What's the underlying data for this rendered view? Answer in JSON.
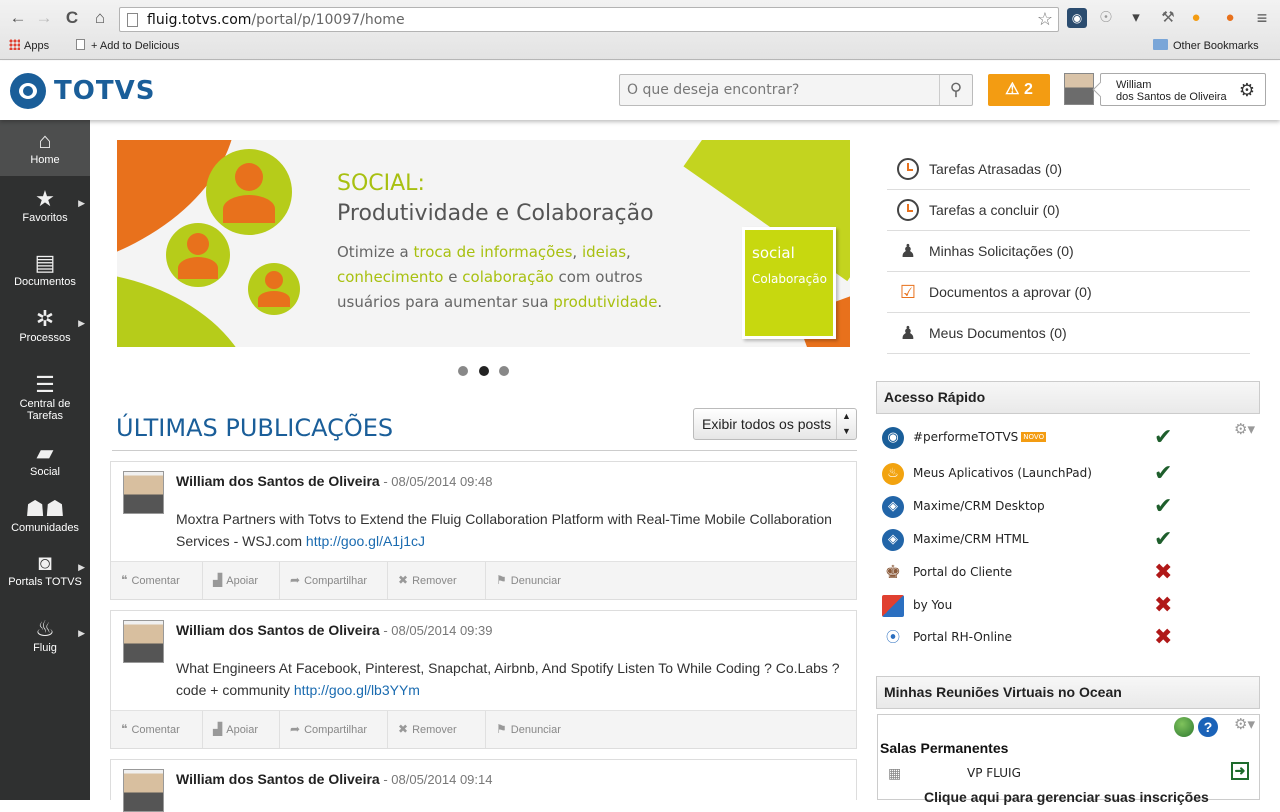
{
  "browser": {
    "url_host": "fluig.totvs.com",
    "url_path": "/portal/p/10097/home",
    "bookmarks": {
      "apps": "Apps",
      "delicious": "+ Add to Delicious",
      "other": "Other Bookmarks"
    }
  },
  "header": {
    "logo": "TOTVS",
    "search_placeholder": "O que deseja encontrar?",
    "alert_count": "2",
    "user_first": "William",
    "user_rest": "dos Santos de Oliveira"
  },
  "sidebar": {
    "items": [
      {
        "label": "Home",
        "icon": "home-icon"
      },
      {
        "label": "Favoritos",
        "icon": "star-icon"
      },
      {
        "label": "Documentos",
        "icon": "documents-icon"
      },
      {
        "label": "Processos",
        "icon": "process-icon"
      },
      {
        "label": "Central de",
        "label2": "Tarefas",
        "icon": "list-icon"
      },
      {
        "label": "Social",
        "icon": "chat-icon"
      },
      {
        "label": "Comunidades",
        "icon": "community-icon"
      },
      {
        "label": "Portals TOTVS",
        "icon": "portal-icon"
      },
      {
        "label": "Fluig",
        "icon": "fluig-icon"
      }
    ]
  },
  "banner": {
    "title": "SOCIAL:",
    "subtitle": "Produtividade e Colaboração",
    "t1": "Otimize a ",
    "h1": "troca de informações",
    "t2": ", ",
    "h2": "ideias",
    "t3": ",",
    "h3": "conhecimento",
    "t4": " e ",
    "h4": "colaboração",
    "t5": " com outros",
    "t6": "usuários para aumentar sua ",
    "h5": "produtividade",
    "t7": ".",
    "box_title": "social",
    "box_sub": "Colaboração",
    "active_slide": 2,
    "slides": 3
  },
  "feed": {
    "title": "ÚLTIMAS PUBLICAÇÕES",
    "filter": "Exibir todos os posts",
    "actions": [
      "Comentar",
      "Apoiar",
      "Compartilhar",
      "Remover",
      "Denunciar"
    ],
    "posts": [
      {
        "author": "William dos Santos de Oliveira",
        "date": " - 08/05/2014 09:48",
        "text": "Moxtra Partners with Totvs to Extend the Fluig Collaboration Platform with Real-Time Mobile Collaboration Services - WSJ.com ",
        "link": "http://goo.gl/A1j1cJ"
      },
      {
        "author": "William dos Santos de Oliveira",
        "date": " - 08/05/2014 09:39",
        "text": "What Engineers At Facebook, Pinterest, Snapchat, Airbnb, And Spotify Listen To While Coding ? Co.Labs ? code + community ",
        "link": "http://goo.gl/lb3YYm"
      },
      {
        "author": "William dos Santos de Oliveira",
        "date": " - 08/05/2014 09:14"
      }
    ]
  },
  "tasks": [
    {
      "label": "Tarefas Atrasadas (0)"
    },
    {
      "label": "Tarefas a concluir (0)"
    },
    {
      "label": "Minhas Solicitações (0)"
    },
    {
      "label": "Documentos a aprovar (0)"
    },
    {
      "label": "Meus Documentos (0)"
    }
  ],
  "quick_access": {
    "title": "Acesso Rápido",
    "novo": "NOVO",
    "items": [
      {
        "label": "#performeTOTVS",
        "status": "ok",
        "color": "#1a5e99"
      },
      {
        "label": "Meus Aplicativos (LaunchPad)",
        "status": "ok",
        "color": "#f2a30f"
      },
      {
        "label": "Maxime/CRM Desktop",
        "status": "ok",
        "color": "#2265a8"
      },
      {
        "label": "Maxime/CRM HTML",
        "status": "ok",
        "color": "#2265a8"
      },
      {
        "label": "Portal do Cliente",
        "status": "no",
        "color": "#8a5a3a"
      },
      {
        "label": "by You",
        "status": "no",
        "color": "#e04030"
      },
      {
        "label": "Portal RH-Online",
        "status": "no",
        "color": "#2b6fc0"
      }
    ]
  },
  "ocean": {
    "title": "Minhas Reuniões Virtuais no Ocean",
    "permanent": "Salas Permanentes",
    "room": "VP FLUIG",
    "manage": "Clique aqui para gerenciar suas inscrições"
  },
  "colors": {
    "brand": "#1a5e99",
    "accent": "#f39c12",
    "sidebar": "#2f3030",
    "banner_green": "#b6cc1a",
    "banner_orange": "#e8711c"
  }
}
